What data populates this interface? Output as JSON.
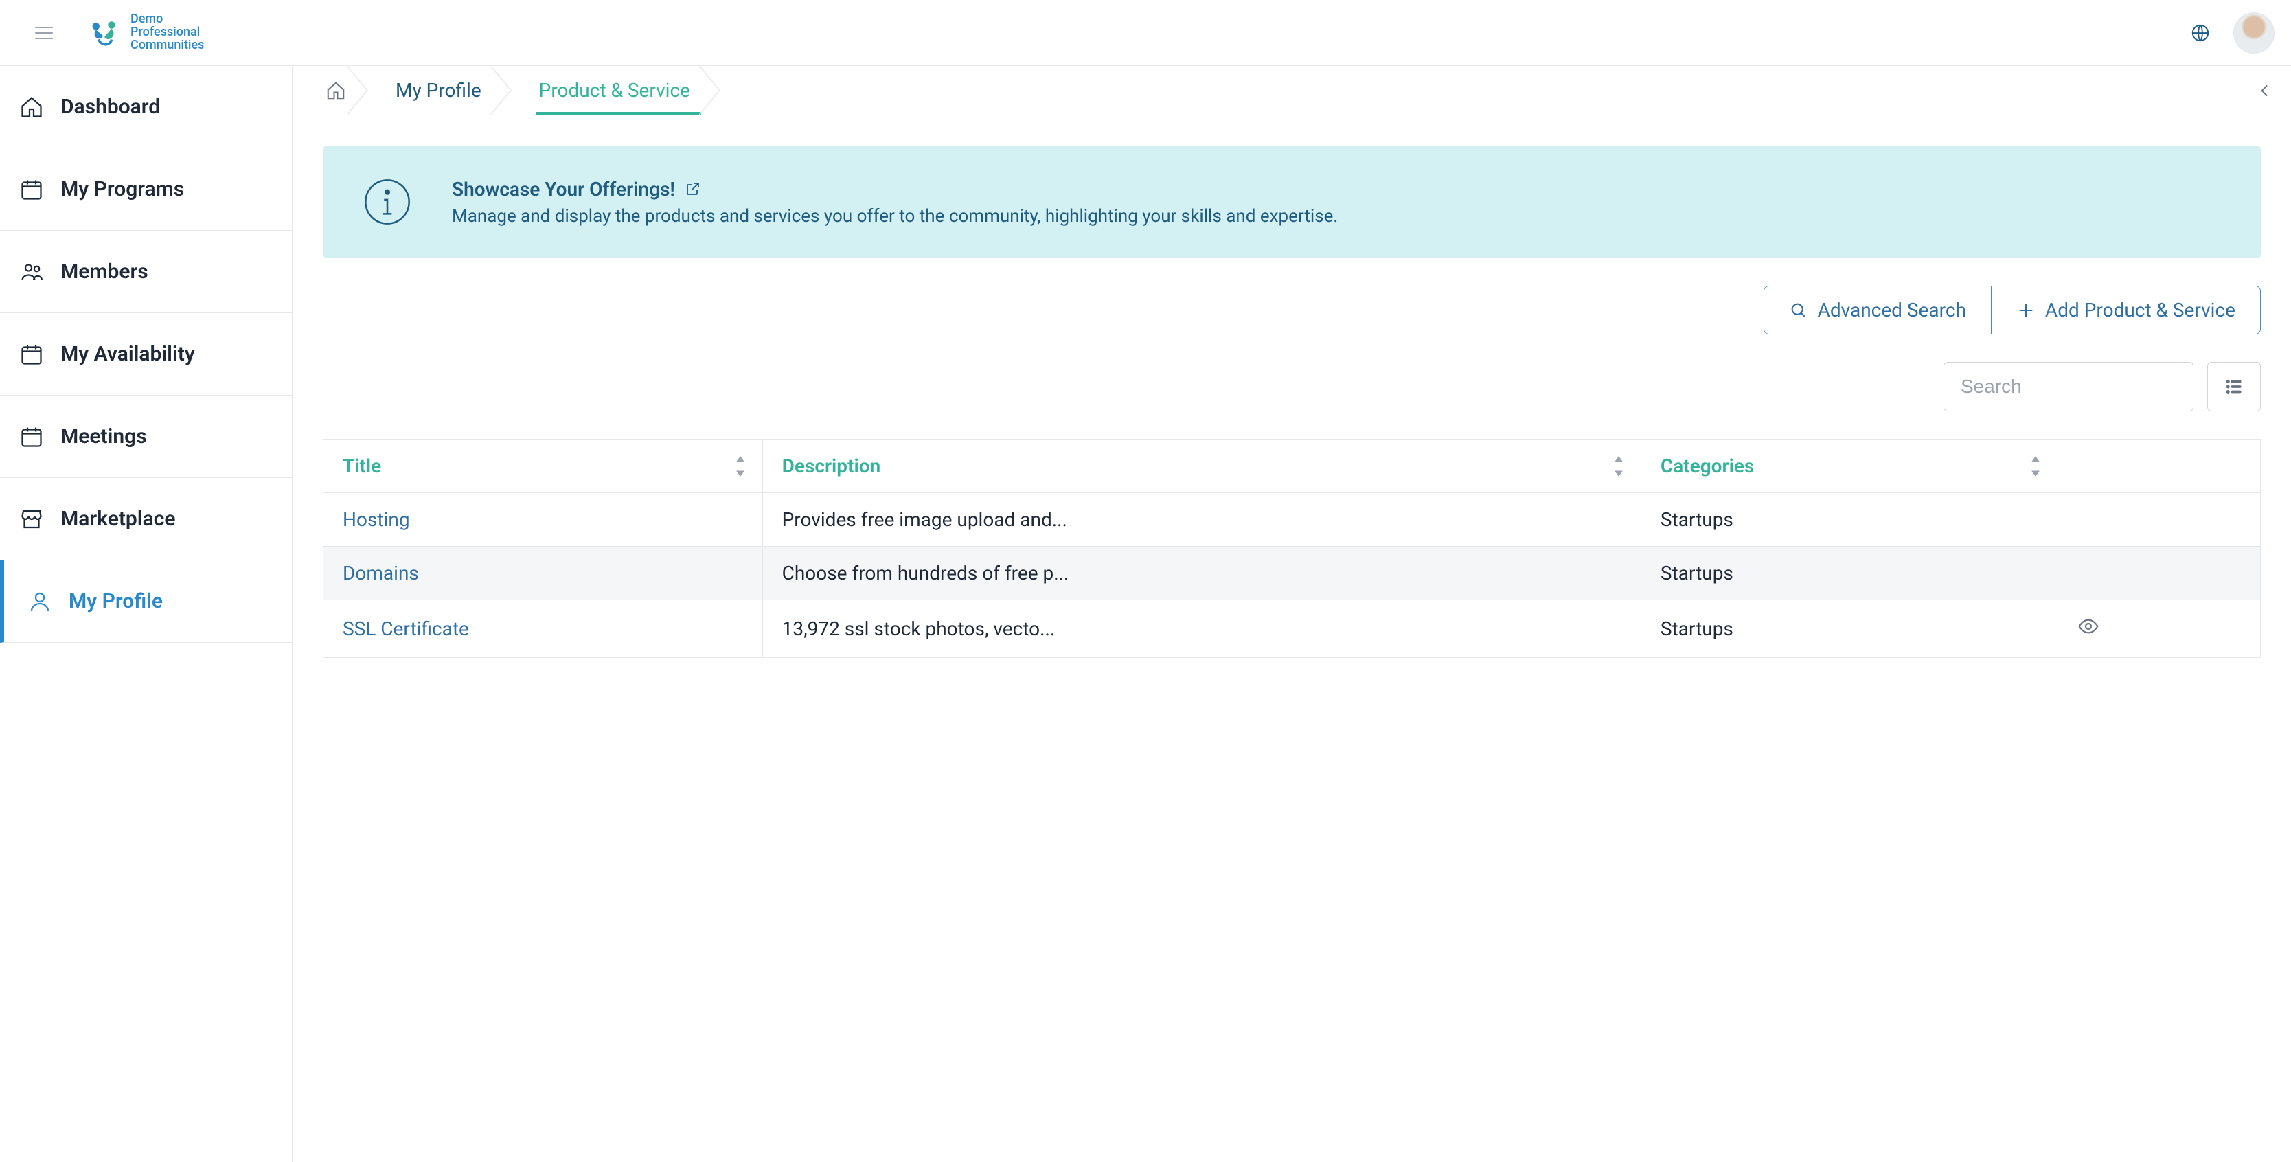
{
  "brand": {
    "line1": "Demo",
    "line2": "Professional",
    "line3": "Communities"
  },
  "sidebar": {
    "items": [
      {
        "label": "Dashboard",
        "icon": "home"
      },
      {
        "label": "My Programs",
        "icon": "calendar"
      },
      {
        "label": "Members",
        "icon": "users"
      },
      {
        "label": "My Availability",
        "icon": "calendar"
      },
      {
        "label": "Meetings",
        "icon": "calendar"
      },
      {
        "label": "Marketplace",
        "icon": "store"
      },
      {
        "label": "My Profile",
        "icon": "user",
        "active": true
      }
    ]
  },
  "breadcrumbs": {
    "items": [
      {
        "label": "My Profile"
      },
      {
        "label": "Product & Service",
        "active": true
      }
    ]
  },
  "banner": {
    "title": "Showcase Your Offerings!",
    "description": "Manage and display the products and services you offer to the community, highlighting your skills and expertise."
  },
  "actions": {
    "advanced_search": "Advanced Search",
    "add_product": "Add Product & Service"
  },
  "search": {
    "placeholder": "Search"
  },
  "table": {
    "columns": {
      "title": "Title",
      "description": "Description",
      "categories": "Categories"
    },
    "rows": [
      {
        "title": "Hosting",
        "description": "Provides free image upload and...",
        "categories": "Startups"
      },
      {
        "title": "Domains",
        "description": "Choose from hundreds of free p...",
        "categories": "Startups"
      },
      {
        "title": "SSL Certificate",
        "description": "13,972 ssl stock photos, vecto...",
        "categories": "Startups",
        "show_view": true
      }
    ]
  }
}
